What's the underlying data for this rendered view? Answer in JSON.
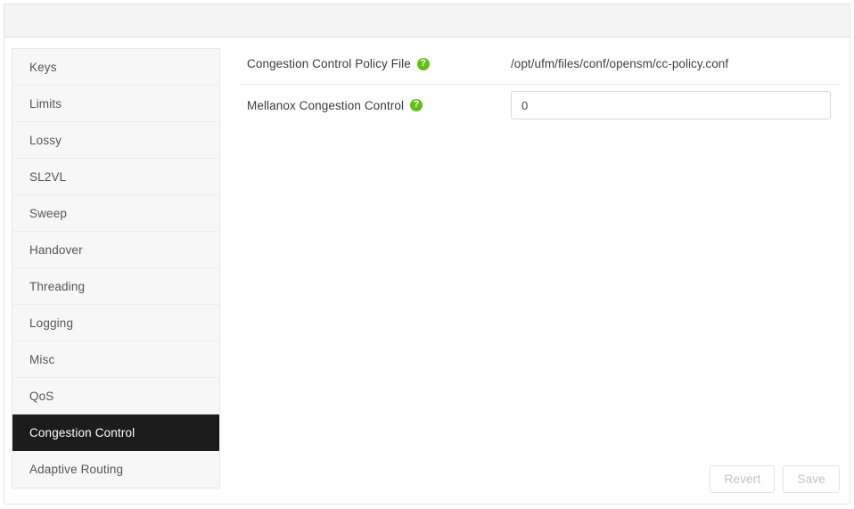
{
  "header": {
    "title": ""
  },
  "sidebar": {
    "selected_index": 10,
    "items": [
      {
        "label": "Keys"
      },
      {
        "label": "Limits"
      },
      {
        "label": "Lossy"
      },
      {
        "label": "SL2VL"
      },
      {
        "label": "Sweep"
      },
      {
        "label": "Handover"
      },
      {
        "label": "Threading"
      },
      {
        "label": "Logging"
      },
      {
        "label": "Misc"
      },
      {
        "label": "QoS"
      },
      {
        "label": "Congestion Control"
      },
      {
        "label": "Adaptive Routing"
      }
    ]
  },
  "main": {
    "rows": [
      {
        "label": "Congestion Control Policy File",
        "help_icon": "help-circle-icon",
        "type": "text",
        "value": "/opt/ufm/files/conf/opensm/cc-policy.conf"
      },
      {
        "label": "Mellanox Congestion Control",
        "help_icon": "help-circle-icon",
        "type": "input",
        "value": "0",
        "placeholder": ""
      }
    ]
  },
  "footer": {
    "revert_label": "Revert",
    "save_label": "Save"
  },
  "colors": {
    "accent_help": "#61bf13",
    "selected_background": "#1c1c1c",
    "header_background": "#f4f4f4",
    "sidebar_background": "#f7f7f7"
  },
  "icons": {
    "help_glyph": "?"
  }
}
